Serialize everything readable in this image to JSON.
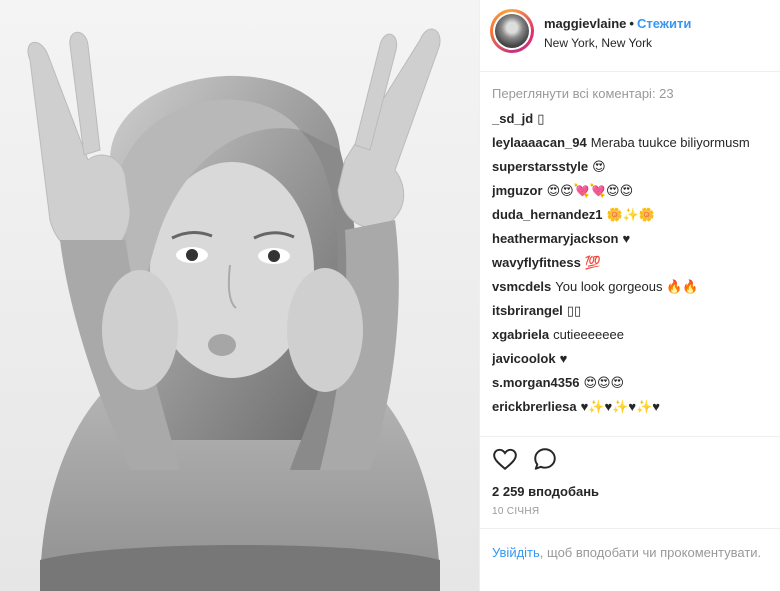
{
  "post": {
    "username": "maggievlaine",
    "separator": "•",
    "follow_label": "Стежити",
    "location": "New York, New York"
  },
  "comments": {
    "view_all": "Переглянути всі коментарі: 23",
    "items": [
      {
        "user": "_sd_jd",
        "text": "▯"
      },
      {
        "user": "leylaaaacan_94",
        "text": "Meraba tuukce biliyormusm"
      },
      {
        "user": "superstarsstyle",
        "text": "😍"
      },
      {
        "user": "jmguzor",
        "text": "😍😍💘💘😍😍"
      },
      {
        "user": "duda_hernandez1",
        "text": "🌼✨🌼"
      },
      {
        "user": "heathermaryjackson",
        "text": "♥"
      },
      {
        "user": "wavyflyfitness",
        "text": "💯"
      },
      {
        "user": "vsmcdels",
        "text": "You look gorgeous 🔥🔥"
      },
      {
        "user": "itsbrirangel",
        "text": "▯▯"
      },
      {
        "user": "xgabriela",
        "text": "cutieeeeeee"
      },
      {
        "user": "javicoolok",
        "text": "♥"
      },
      {
        "user": "s.morgan4356",
        "text": "😍😍😍"
      },
      {
        "user": "erickbrerliesa",
        "text": "♥✨♥✨♥✨♥"
      }
    ]
  },
  "icons": {
    "like": "heart-icon",
    "comment": "comment-bubble-icon"
  },
  "stats": {
    "likes": "2 259 вподобань",
    "date": "10 СІЧНЯ"
  },
  "login_prompt": {
    "link": "Увійдіть",
    "rest": ", щоб вподобати чи прокоментувати."
  },
  "colors": {
    "accent": "#3897f0",
    "muted": "#999999",
    "text": "#262626"
  }
}
